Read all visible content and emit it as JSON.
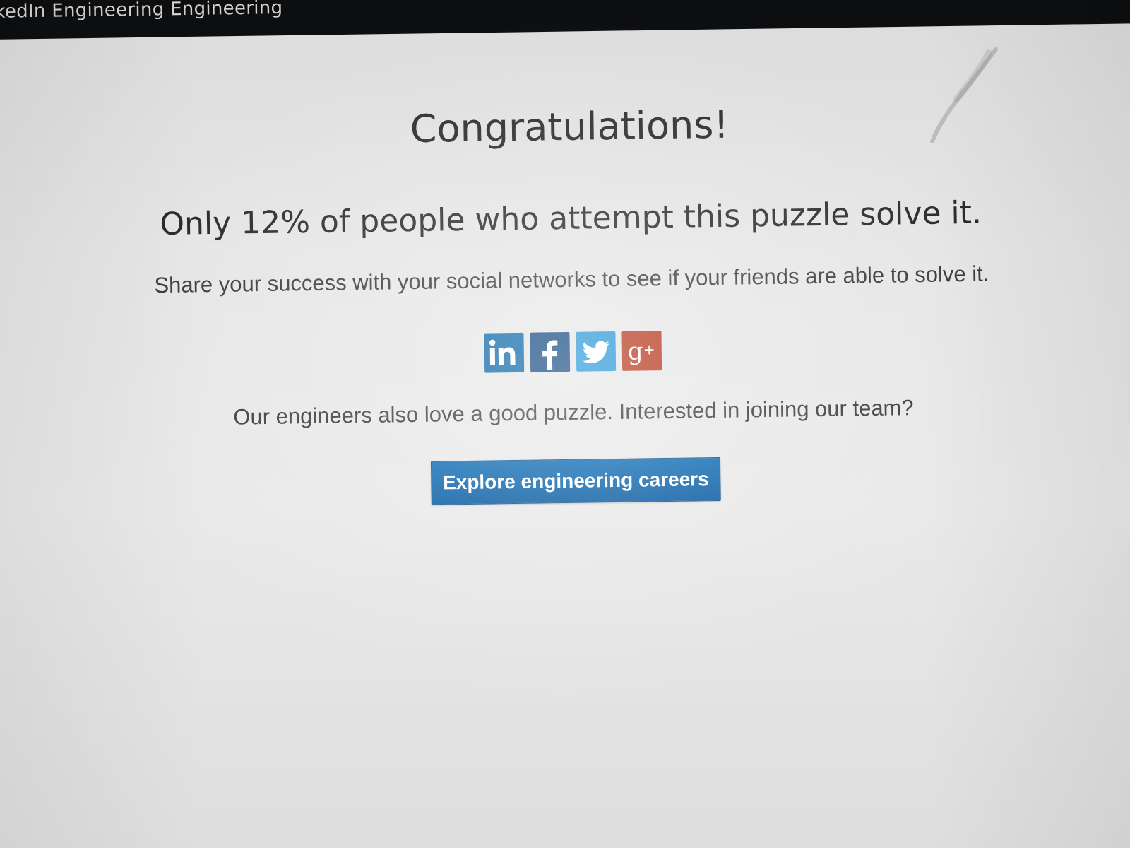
{
  "topbar": {
    "title": "kedIn Engineering  Engineering"
  },
  "main": {
    "heading": "Congratulations!",
    "subheading": "Only 12% of people who attempt this puzzle solve it.",
    "share_text": "Share your success with your social networks to see if your friends are able to solve it.",
    "social": [
      {
        "name": "linkedin",
        "icon": "linkedin-icon",
        "color": "#0a66a8"
      },
      {
        "name": "facebook",
        "icon": "facebook-icon",
        "color": "#12477e"
      },
      {
        "name": "twitter",
        "icon": "twitter-icon",
        "color": "#2796d8"
      },
      {
        "name": "google-plus",
        "icon": "google-plus-icon",
        "color": "#b5381e"
      }
    ],
    "careers_text": "Our engineers also love a good puzzle. Interested in joining our team?",
    "cta_label": "Explore engineering careers"
  },
  "colors": {
    "accent": "#0a66b0",
    "background": "#e4e4e4",
    "topbar": "#0d0e10"
  }
}
